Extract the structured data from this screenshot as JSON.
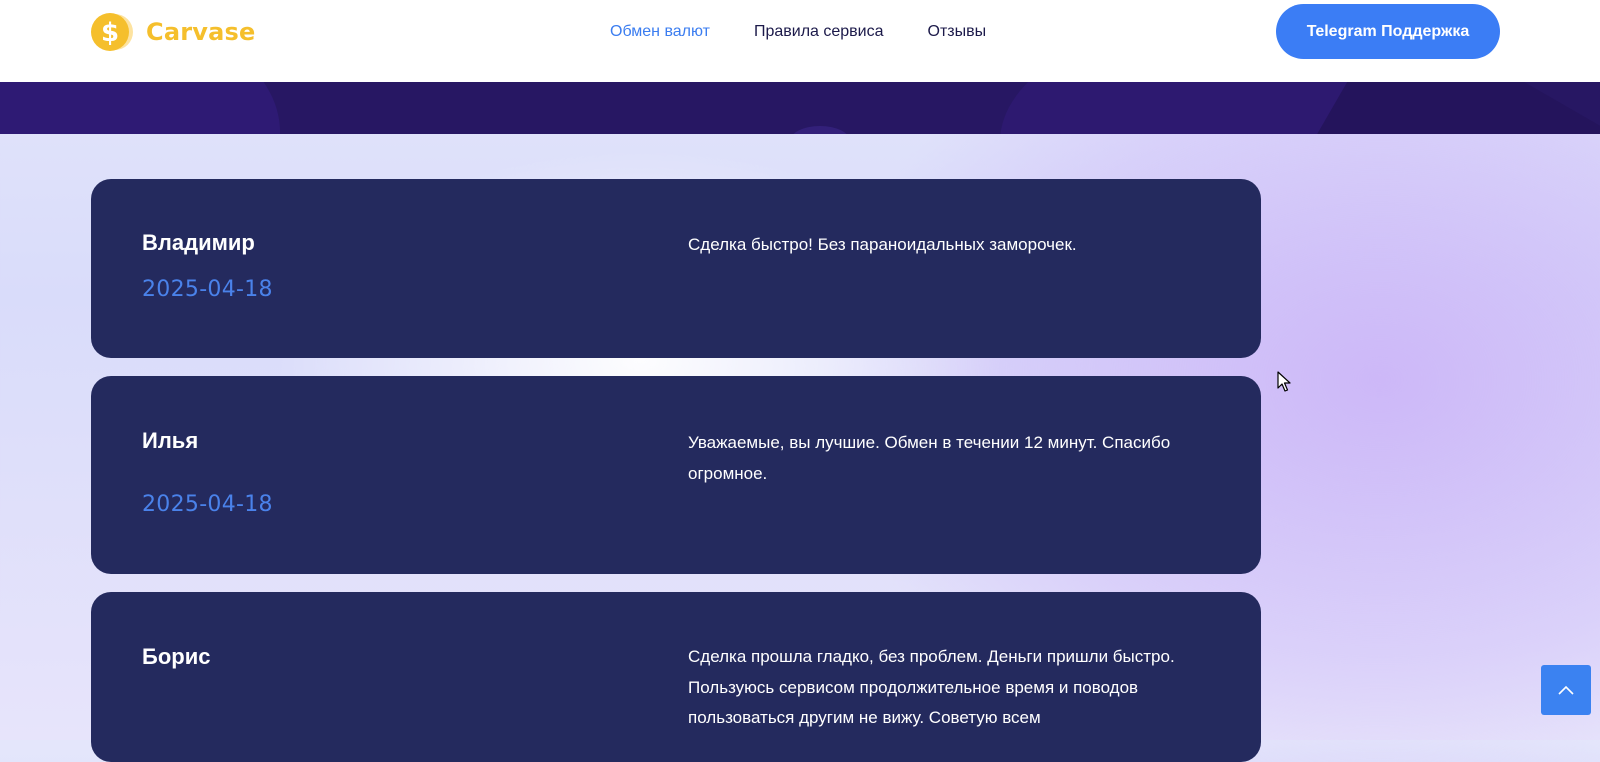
{
  "header": {
    "logo_text": "Carvase",
    "nav": [
      {
        "label": "Обмен валют",
        "active": true
      },
      {
        "label": "Правила сервиса",
        "active": false
      },
      {
        "label": "Отзывы",
        "active": false
      }
    ],
    "cta_label": "Telegram Поддержка"
  },
  "reviews": [
    {
      "name": "Владимир",
      "date": "2025-04-18",
      "text": "Сделка быстро! Без параноидальных заморочек."
    },
    {
      "name": "Илья",
      "date": "2025-04-18",
      "text": "Уважаемые, вы лучшие. Обмен в течении 12 минут. Спасибо огромное."
    },
    {
      "name": "Борис",
      "date": "",
      "text": "Сделка прошла гладко, без проблем. Деньги пришли быстро. Пользуюсь сервисом продолжительное время и поводов пользоваться другим не вижу. Советую всем"
    }
  ],
  "colors": {
    "accent": "#3b7df5",
    "logo": "#f5bf2c",
    "card_bg": "#242a5e",
    "date": "#4a82ea",
    "banner": "#271763"
  },
  "icons": {
    "logo": "dollar-coin-icon",
    "scroll_top": "chevron-up-icon",
    "cursor": "mouse-pointer-icon"
  }
}
